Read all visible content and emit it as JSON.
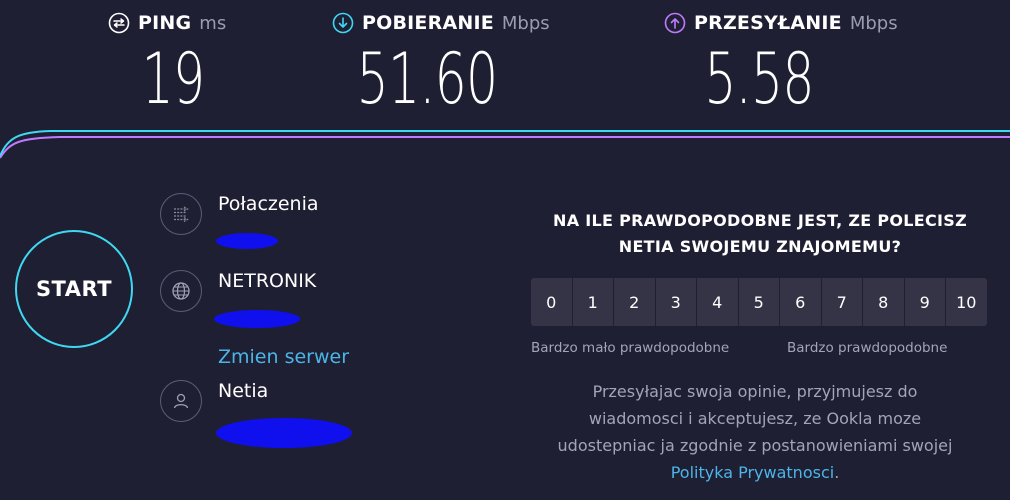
{
  "metrics": {
    "ping": {
      "label": "PING",
      "unit": "ms",
      "value": "19",
      "icon": "ping-icon",
      "color": "#ffffff"
    },
    "download": {
      "label": "POBIERANIE",
      "unit": "Mbps",
      "value": "51.60",
      "icon": "download-arrow-icon",
      "color": "#3fd8f2"
    },
    "upload": {
      "label": "PRZESYŁANIE",
      "unit": "Mbps",
      "value": "5.58",
      "icon": "upload-arrow-icon",
      "color": "#bf7bff"
    }
  },
  "start_button": {
    "label": "START"
  },
  "connections": {
    "title": "Połaczenia",
    "icon": "connections-icon"
  },
  "server": {
    "title": "NETRONIK",
    "change_link": "Zmien serwer",
    "icon": "globe-icon"
  },
  "provider": {
    "title": "Netia",
    "icon": "user-icon"
  },
  "survey": {
    "question_line1": "NA ILE PRAWDOPODOBNE JEST, ZE POLECISZ",
    "question_line2": "NETIA SWOJEMU ZNAJOMEMU?",
    "scale": [
      "0",
      "1",
      "2",
      "3",
      "4",
      "5",
      "6",
      "7",
      "8",
      "9",
      "10"
    ],
    "low_label": "Bardzo mało prawdopodobne",
    "high_label": "Bardzo prawdopodobne",
    "consent_line1": "Przesyłajac swoja opinie, przyjmujesz do",
    "consent_line2": "wiadomosci i akceptujesz, ze Ookla moze",
    "consent_line3": "udostepniac ja zgodnie z postanowieniami swojej",
    "privacy_link": "Polityka Prywatnosci",
    "consent_end": "."
  },
  "colors": {
    "background": "#1f1f33",
    "accent_cyan": "#3fd8f2",
    "accent_purple": "#bf7bff",
    "link": "#4bb5e8",
    "redaction": "#1010ee"
  }
}
